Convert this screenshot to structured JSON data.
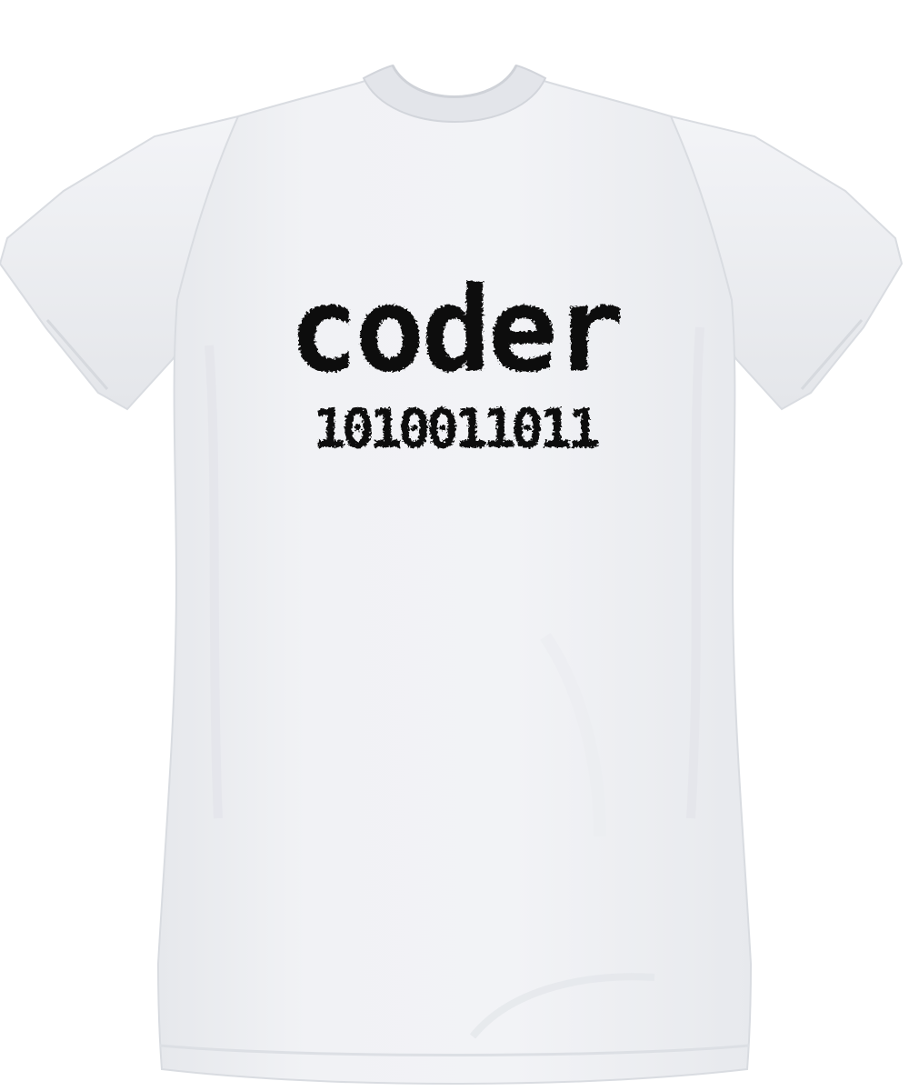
{
  "product": {
    "garment": "t-shirt",
    "garment_color": "#eef0f3",
    "ink_color": "#0b0b0b",
    "print": {
      "word": "coder",
      "binary": "1010011011"
    }
  }
}
